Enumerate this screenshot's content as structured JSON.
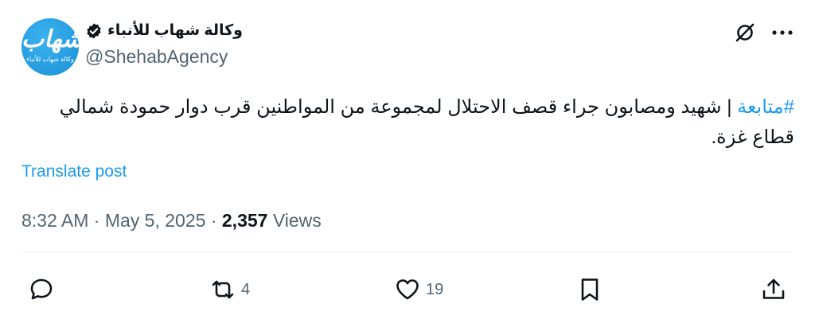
{
  "author": {
    "display_name": "وكالة شهاب للأنباء",
    "handle": "@ShehabAgency",
    "avatar_glyph": "شهاب",
    "avatar_caption": "وكالة شهاب للأنباء",
    "verified": true
  },
  "tweet": {
    "hashtag": "#متابعة",
    "text": " | شهيد ومصابون جراء قصف الاحتلال لمجموعة من المواطنين قرب دوار حمودة شمالي قطاع غزة."
  },
  "translate_label": "Translate post",
  "meta": {
    "time": "8:32 AM",
    "separator": "·",
    "date": "May 5, 2025",
    "views_count": "2,357",
    "views_label": "Views"
  },
  "actions": {
    "reply_count": "",
    "retweet_count": "4",
    "like_count": "19"
  },
  "colors": {
    "accent": "#1d9bf0",
    "muted": "#536471",
    "text": "#0f1419"
  }
}
